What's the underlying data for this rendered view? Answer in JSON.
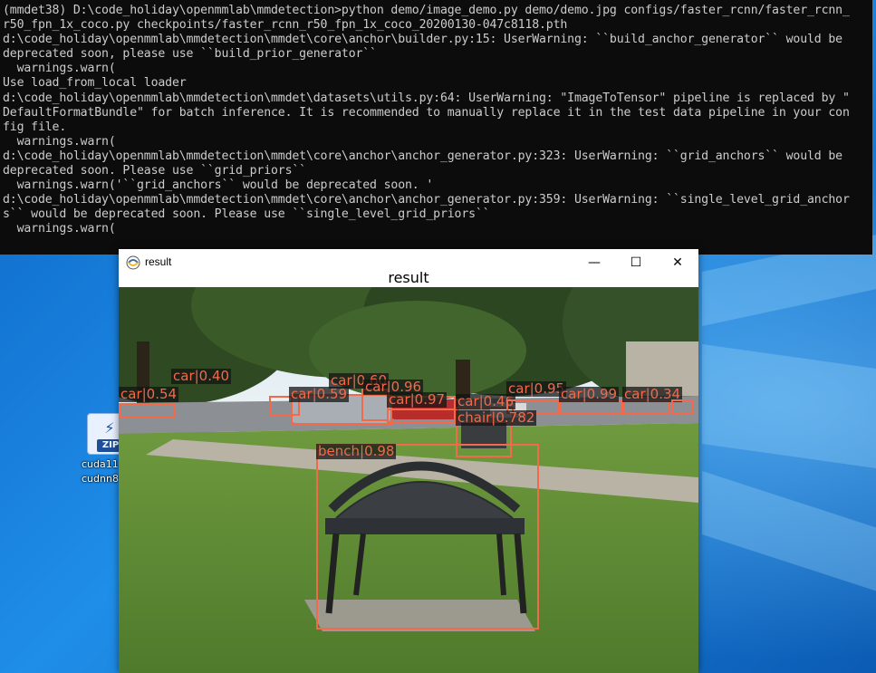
{
  "console": {
    "lines": [
      "(mmdet38) D:\\code_holiday\\openmmlab\\mmdetection>python demo/image_demo.py demo/demo.jpg configs/faster_rcnn/faster_rcnn_",
      "r50_fpn_1x_coco.py checkpoints/faster_rcnn_r50_fpn_1x_coco_20200130-047c8118.pth",
      "d:\\code_holiday\\openmmlab\\mmdetection\\mmdet\\core\\anchor\\builder.py:15: UserWarning: ``build_anchor_generator`` would be",
      "deprecated soon, please use ``build_prior_generator``",
      "  warnings.warn(",
      "Use load_from_local loader",
      "d:\\code_holiday\\openmmlab\\mmdetection\\mmdet\\datasets\\utils.py:64: UserWarning: \"ImageToTensor\" pipeline is replaced by \"",
      "DefaultFormatBundle\" for batch inference. It is recommended to manually replace it in the test data pipeline in your con",
      "fig file.",
      "  warnings.warn(",
      "d:\\code_holiday\\openmmlab\\mmdetection\\mmdet\\core\\anchor\\anchor_generator.py:323: UserWarning: ``grid_anchors`` would be",
      "deprecated soon. Please use ``grid_priors``",
      "  warnings.warn('``grid_anchors`` would be deprecated soon. '",
      "d:\\code_holiday\\openmmlab\\mmdetection\\mmdet\\core\\anchor\\anchor_generator.py:359: UserWarning: ``single_level_grid_anchor",
      "s`` would be deprecated soon. Please use ``single_level_grid_priors``",
      "  warnings.warn("
    ]
  },
  "window": {
    "title": "result",
    "plot_title": "result",
    "minimize_glyph": "—",
    "maximize_glyph": "☐",
    "close_glyph": "✕"
  },
  "desktop_icon": {
    "badge": "ZIP",
    "label_line1": "cuda11",
    "label_line2": "cudnn8"
  },
  "detections": [
    {
      "label": "car|0.54"
    },
    {
      "label": "car|0.40"
    },
    {
      "label": "car|0.59"
    },
    {
      "label": "car|0.60"
    },
    {
      "label": "car|0.96"
    },
    {
      "label": "car|0.97"
    },
    {
      "label": "car|0.46"
    },
    {
      "label": "car|0.95"
    },
    {
      "label": "car|0.99"
    },
    {
      "label": "car|0.34"
    },
    {
      "label": "chair|0.782"
    },
    {
      "label": "bench|0.98"
    }
  ],
  "colors": {
    "console_bg": "#0c0c0c",
    "console_fg": "#cccccc",
    "box": "#f26a4a",
    "desktop": "#1f8ee8"
  }
}
